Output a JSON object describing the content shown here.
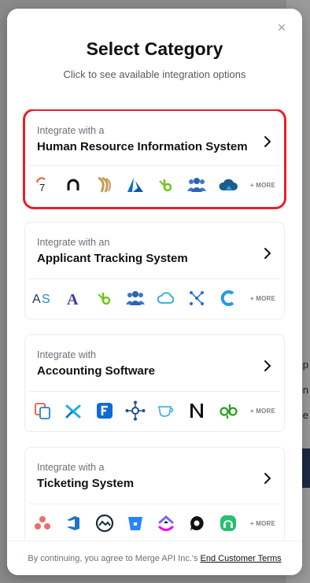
{
  "background": {
    "fragments": [
      "p",
      "n",
      "lle"
    ]
  },
  "modal": {
    "close_glyph": "×",
    "title": "Select Category",
    "subtitle": "Click to see available integration options"
  },
  "categories": [
    {
      "pre": "Integrate with a",
      "name": "Human Resource Information System",
      "more": "+ MORE",
      "logos": [
        "sevenshifts-icon",
        "alexishr-icon",
        "wheat-logo-icon",
        "azure-ad-icon",
        "bamboohr-icon",
        "people-group-icon",
        "cloud-hr-icon"
      ]
    },
    {
      "pre": "Integrate with an",
      "name": "Applicant Tracking System",
      "more": "+ MORE",
      "logos": [
        "as-logo-icon",
        "ashby-icon",
        "bamboohr-icon",
        "people-group-icon",
        "cloud-outline-icon",
        "workable-icon",
        "c-logo-icon"
      ]
    },
    {
      "pre": "Integrate with",
      "name": "Accounting Software",
      "more": "+ MORE",
      "logos": [
        "copies-icon",
        "xero-x-icon",
        "freshbooks-icon",
        "network-hub-icon",
        "cup-icon",
        "netsuite-icon",
        "quickbooks-icon"
      ]
    },
    {
      "pre": "Integrate with a",
      "name": "Ticketing System",
      "more": "+ MORE",
      "logos": [
        "asana-icon",
        "azure-devops-icon",
        "basecamp-icon",
        "bitbucket-icon",
        "clickup-icon",
        "speech-icon",
        "freshdesk-icon"
      ]
    }
  ],
  "footer": {
    "text": "By continuing, you agree to Merge API Inc.'s",
    "link": "End Customer Terms"
  },
  "colors": {
    "highlight": "#e8202a"
  }
}
